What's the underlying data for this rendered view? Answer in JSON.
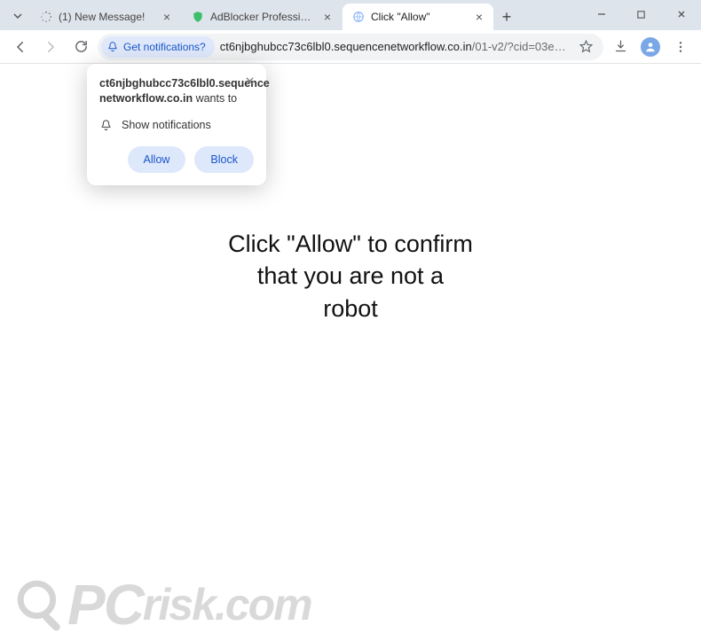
{
  "window": {
    "minimize": "–",
    "maximize": "□",
    "close": "✕"
  },
  "tabs": [
    {
      "title": "(1) New Message!",
      "favicon": "spinner"
    },
    {
      "title": "AdBlocker Professional",
      "favicon": "shield"
    },
    {
      "title": "Click \"Allow\"",
      "favicon": "globe",
      "active": true
    }
  ],
  "newtab_label": "+",
  "toolbar": {
    "chip_label": "Get notifications?",
    "url_domain": "ct6njbghubcc73c6lbl0.sequencenetworkflow.co.in",
    "url_path": "/01-v2/?cid=03e6d9e0efa9aafb1a02&list=7&e..."
  },
  "permission_popup": {
    "origin_line1": "ct6njbghubcc73c6lbl0.sequence",
    "origin_line2": "networkflow.co.in",
    "wants_to": " wants to",
    "capability": "Show notifications",
    "allow": "Allow",
    "block": "Block"
  },
  "page": {
    "headline": "Click \"Allow\" to confirm\nthat you are not a\nrobot"
  },
  "watermark": {
    "text_pc": "PC",
    "text_risk": "risk",
    "text_com": ".com"
  }
}
